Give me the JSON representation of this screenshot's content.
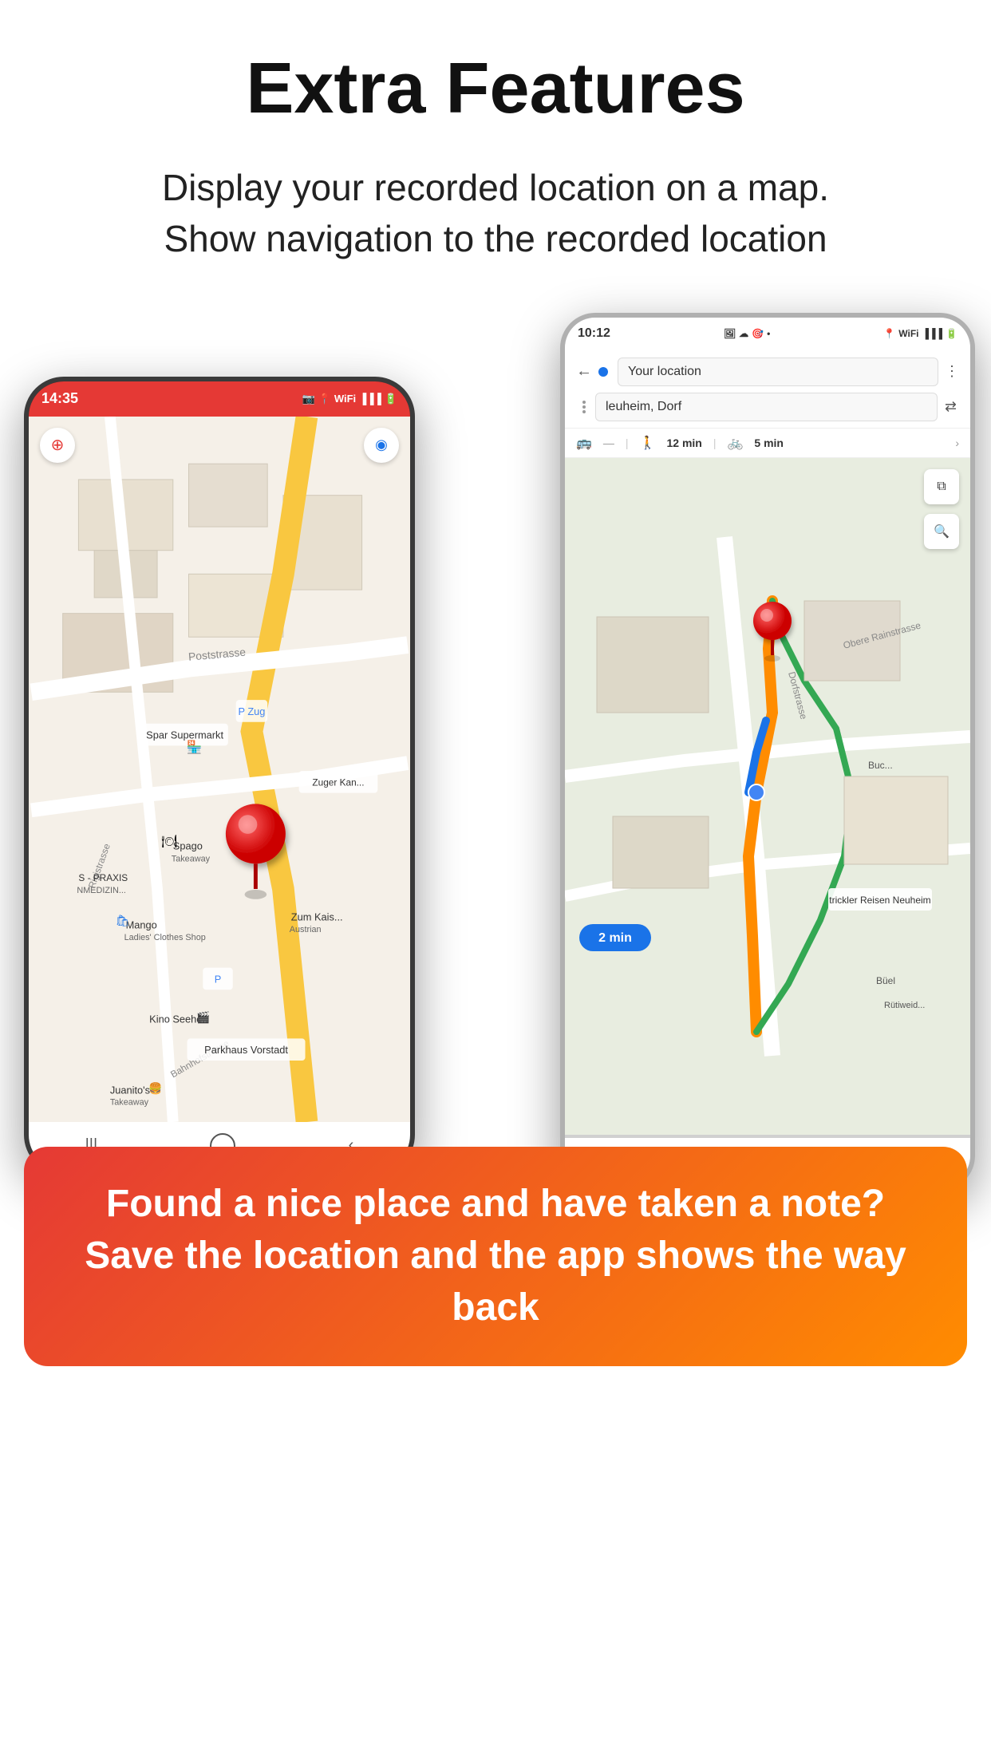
{
  "page": {
    "title": "Extra Features",
    "subtitle": "Display your recorded location on a map.\nShow navigation to the recorded location"
  },
  "phone_left": {
    "status_bar": {
      "time": "14:35",
      "icons": "📷 🖼 ⚠ •",
      "right_icons": "📍 WiFi ▐▐▐ 🔋"
    }
  },
  "phone_right": {
    "status_bar": {
      "time": "10:12",
      "icons": "🖼 ☁ 🎯 •",
      "right_icons": "📍 WiFi ▐▐▐ 🔋"
    },
    "search_placeholder": "Your location",
    "destination": "leuheim, Dorf",
    "transport_modes": [
      {
        "icon": "🚌",
        "label": "--"
      },
      {
        "icon": "🚶",
        "time": "12 min"
      },
      {
        "icon": "🚲",
        "time": "5 min"
      }
    ],
    "time_badge": "2 min"
  },
  "callout": {
    "text": "Found a nice place and have taken a note? Save the location and the app shows the way back"
  },
  "icons": {
    "compass": "⊕",
    "location": "◎",
    "back_arrow": "←",
    "more_vert": "⋮",
    "swap": "⇅",
    "layers": "⧉",
    "search": "🔍"
  }
}
